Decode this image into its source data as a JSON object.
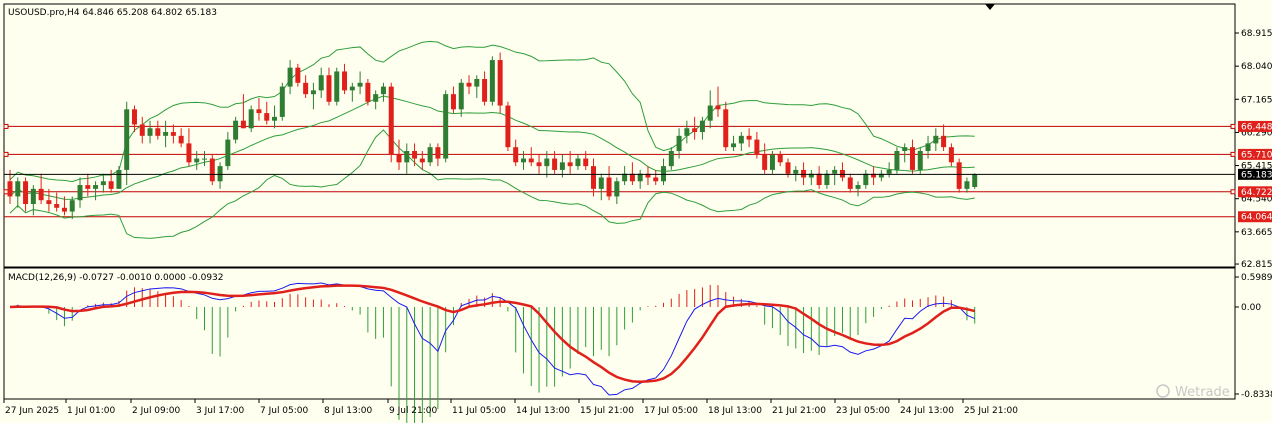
{
  "header": {
    "symbol_info": "USOUSD.pro,H4  64.846 65.208 64.802 65.183",
    "macd_info": "MACD(12,26,9) -0.0727 -0.0010 0.0000 -0.0932"
  },
  "colors": {
    "background": "#fffff0",
    "bull_candle": "#2e7d32",
    "bear_candle": "#e0201a",
    "bollinger": "#2e9e3a",
    "horizontal_levels": "#c00000",
    "level_label_bg": "#e0201a",
    "macd_line": "#1a1aee",
    "signal_line": "#e0201a",
    "hist_positive": "#e0201a",
    "hist_negative": "#2e9e3a"
  },
  "price_axis": {
    "ticks": [
      "68.915",
      "68.040",
      "67.165",
      "66.290",
      "65.415",
      "64.540",
      "63.665",
      "62.815"
    ],
    "current_price": "65.183"
  },
  "macd_axis": {
    "ticks": [
      "0.5989",
      "0.00",
      "-0.8338"
    ]
  },
  "time_axis": {
    "labels": [
      "27 Jun 2025",
      "1 Jul 01:00",
      "2 Jul 09:00",
      "3 Jul 17:00",
      "7 Jul 05:00",
      "8 Jul 13:00",
      "9 Jul 21:00",
      "11 Jul 05:00",
      "14 Jul 13:00",
      "15 Jul 21:00",
      "17 Jul 05:00",
      "18 Jul 13:00",
      "21 Jul 21:00",
      "23 Jul 05:00",
      "24 Jul 13:00",
      "25 Jul 21:00"
    ]
  },
  "levels": [
    {
      "price": "66.448"
    },
    {
      "price": "65.710"
    },
    {
      "price": "64.722"
    },
    {
      "price": "64.064"
    }
  ],
  "watermark": "Wetrade",
  "chart_data": {
    "type": "candlestick",
    "ylim": [
      62.815,
      69.3
    ],
    "yticks": [
      68.915,
      68.04,
      67.165,
      66.29,
      65.415,
      64.54,
      63.665,
      62.815
    ],
    "ohlc": [
      [
        65.0,
        65.3,
        64.4,
        64.6
      ],
      [
        64.6,
        65.1,
        64.3,
        65.0
      ],
      [
        65.0,
        65.1,
        64.2,
        64.4
      ],
      [
        64.4,
        64.9,
        64.1,
        64.8
      ],
      [
        64.8,
        65.2,
        64.4,
        64.5
      ],
      [
        64.5,
        64.8,
        64.2,
        64.4
      ],
      [
        64.4,
        64.7,
        64.2,
        64.3
      ],
      [
        64.3,
        64.6,
        64.1,
        64.2
      ],
      [
        64.2,
        64.6,
        64.0,
        64.5
      ],
      [
        64.5,
        65.1,
        64.3,
        64.9
      ],
      [
        64.9,
        65.2,
        64.6,
        64.8
      ],
      [
        64.8,
        65.0,
        64.5,
        64.9
      ],
      [
        64.9,
        65.2,
        64.7,
        65.0
      ],
      [
        65.0,
        65.3,
        64.7,
        64.8
      ],
      [
        64.8,
        65.4,
        64.8,
        65.3
      ],
      [
        65.3,
        67.1,
        64.9,
        66.9
      ],
      [
        66.9,
        67.0,
        66.3,
        66.5
      ],
      [
        66.5,
        66.7,
        66.0,
        66.2
      ],
      [
        66.2,
        66.6,
        66.0,
        66.4
      ],
      [
        66.4,
        66.6,
        66.1,
        66.2
      ],
      [
        66.2,
        66.6,
        65.9,
        66.3
      ],
      [
        66.3,
        66.5,
        66.0,
        66.2
      ],
      [
        66.2,
        66.4,
        65.9,
        66.0
      ],
      [
        66.0,
        66.4,
        65.4,
        65.5
      ],
      [
        65.5,
        65.8,
        65.3,
        65.6
      ],
      [
        65.6,
        65.8,
        65.4,
        65.6
      ],
      [
        65.6,
        65.7,
        64.9,
        65.0
      ],
      [
        65.0,
        65.5,
        64.8,
        65.4
      ],
      [
        65.4,
        66.3,
        65.3,
        66.1
      ],
      [
        66.1,
        66.7,
        66.0,
        66.6
      ],
      [
        66.6,
        67.3,
        66.4,
        66.4
      ],
      [
        66.4,
        67.0,
        66.3,
        66.9
      ],
      [
        66.9,
        67.2,
        66.6,
        66.8
      ],
      [
        66.8,
        67.1,
        66.5,
        66.6
      ],
      [
        66.6,
        67.0,
        66.4,
        66.7
      ],
      [
        66.7,
        67.6,
        66.6,
        67.5
      ],
      [
        67.5,
        68.2,
        67.3,
        68.0
      ],
      [
        68.0,
        68.1,
        67.5,
        67.6
      ],
      [
        67.6,
        67.8,
        67.2,
        67.3
      ],
      [
        67.3,
        67.6,
        66.9,
        67.4
      ],
      [
        67.4,
        68.0,
        67.2,
        67.8
      ],
      [
        67.8,
        68.0,
        67.0,
        67.1
      ],
      [
        67.1,
        68.0,
        67.0,
        67.9
      ],
      [
        67.9,
        68.1,
        67.3,
        67.4
      ],
      [
        67.4,
        67.6,
        67.1,
        67.5
      ],
      [
        67.5,
        67.9,
        67.3,
        67.6
      ],
      [
        67.6,
        67.7,
        67.0,
        67.1
      ],
      [
        67.1,
        67.4,
        66.9,
        67.3
      ],
      [
        67.3,
        67.6,
        67.1,
        67.5
      ],
      [
        67.5,
        67.6,
        65.5,
        65.7
      ],
      [
        65.7,
        66.1,
        65.3,
        65.5
      ],
      [
        65.5,
        66.0,
        65.2,
        65.8
      ],
      [
        65.8,
        66.0,
        65.4,
        65.6
      ],
      [
        65.6,
        65.8,
        65.3,
        65.5
      ],
      [
        65.5,
        66.0,
        65.4,
        65.9
      ],
      [
        65.9,
        66.0,
        65.4,
        65.6
      ],
      [
        65.6,
        67.4,
        65.5,
        67.3
      ],
      [
        67.3,
        67.5,
        66.8,
        66.9
      ],
      [
        66.9,
        67.7,
        66.7,
        67.6
      ],
      [
        67.6,
        67.8,
        67.3,
        67.5
      ],
      [
        67.5,
        67.8,
        67.2,
        67.7
      ],
      [
        67.7,
        67.9,
        67.0,
        67.1
      ],
      [
        67.1,
        68.3,
        67.0,
        68.2
      ],
      [
        68.2,
        68.4,
        66.8,
        67.0
      ],
      [
        67.0,
        67.1,
        65.8,
        65.9
      ],
      [
        65.9,
        66.1,
        65.4,
        65.5
      ],
      [
        65.5,
        65.8,
        65.3,
        65.6
      ],
      [
        65.6,
        65.9,
        65.4,
        65.5
      ],
      [
        65.5,
        65.7,
        65.2,
        65.4
      ],
      [
        65.4,
        65.8,
        65.1,
        65.6
      ],
      [
        65.6,
        65.8,
        65.2,
        65.3
      ],
      [
        65.3,
        65.7,
        65.1,
        65.5
      ],
      [
        65.5,
        65.8,
        65.2,
        65.4
      ],
      [
        65.4,
        65.7,
        65.3,
        65.6
      ],
      [
        65.6,
        65.8,
        65.3,
        65.4
      ],
      [
        65.4,
        65.6,
        64.6,
        64.8
      ],
      [
        64.8,
        65.2,
        64.5,
        65.1
      ],
      [
        65.1,
        65.4,
        64.5,
        64.6
      ],
      [
        64.6,
        65.1,
        64.4,
        65.0
      ],
      [
        65.0,
        65.4,
        64.9,
        65.2
      ],
      [
        65.2,
        65.5,
        64.9,
        65.0
      ],
      [
        65.0,
        65.3,
        64.8,
        65.2
      ],
      [
        65.2,
        65.4,
        64.9,
        65.1
      ],
      [
        65.1,
        65.3,
        64.9,
        65.0
      ],
      [
        65.0,
        65.6,
        64.9,
        65.4
      ],
      [
        65.4,
        65.9,
        65.3,
        65.8
      ],
      [
        65.8,
        66.4,
        65.6,
        66.2
      ],
      [
        66.2,
        66.6,
        66.0,
        66.4
      ],
      [
        66.4,
        66.7,
        66.1,
        66.3
      ],
      [
        66.3,
        66.7,
        66.1,
        66.6
      ],
      [
        66.6,
        67.4,
        66.4,
        67.0
      ],
      [
        67.0,
        67.5,
        66.7,
        66.9
      ],
      [
        66.9,
        67.1,
        65.8,
        65.9
      ],
      [
        65.9,
        66.2,
        65.8,
        66.0
      ],
      [
        66.0,
        66.3,
        65.8,
        66.2
      ],
      [
        66.2,
        66.4,
        65.9,
        66.1
      ],
      [
        66.1,
        66.3,
        65.6,
        65.7
      ],
      [
        65.7,
        66.0,
        65.2,
        65.3
      ],
      [
        65.3,
        65.8,
        65.2,
        65.7
      ],
      [
        65.7,
        65.8,
        65.4,
        65.5
      ],
      [
        65.5,
        65.6,
        65.1,
        65.2
      ],
      [
        65.2,
        65.4,
        65.0,
        65.3
      ],
      [
        65.3,
        65.5,
        64.9,
        65.1
      ],
      [
        65.1,
        65.3,
        64.9,
        65.2
      ],
      [
        65.2,
        65.4,
        64.8,
        64.9
      ],
      [
        64.9,
        65.3,
        64.8,
        65.2
      ],
      [
        65.2,
        65.4,
        64.9,
        65.3
      ],
      [
        65.3,
        65.5,
        65.0,
        65.1
      ],
      [
        65.1,
        65.2,
        64.7,
        64.8
      ],
      [
        64.8,
        65.0,
        64.6,
        64.9
      ],
      [
        64.9,
        65.3,
        64.8,
        65.2
      ],
      [
        65.2,
        65.4,
        64.9,
        65.1
      ],
      [
        65.1,
        65.3,
        65.0,
        65.2
      ],
      [
        65.2,
        65.5,
        65.1,
        65.3
      ],
      [
        65.3,
        65.9,
        65.2,
        65.8
      ],
      [
        65.8,
        66.0,
        65.5,
        65.9
      ],
      [
        65.9,
        66.1,
        65.2,
        65.3
      ],
      [
        65.3,
        65.9,
        65.2,
        65.8
      ],
      [
        65.8,
        66.2,
        65.6,
        66.0
      ],
      [
        66.0,
        66.4,
        65.8,
        66.2
      ],
      [
        66.2,
        66.5,
        65.8,
        65.9
      ],
      [
        65.9,
        66.0,
        65.4,
        65.5
      ],
      [
        65.5,
        65.6,
        64.7,
        64.8
      ],
      [
        64.8,
        65.1,
        64.7,
        65.0
      ],
      [
        64.85,
        65.21,
        64.8,
        65.18
      ]
    ]
  }
}
